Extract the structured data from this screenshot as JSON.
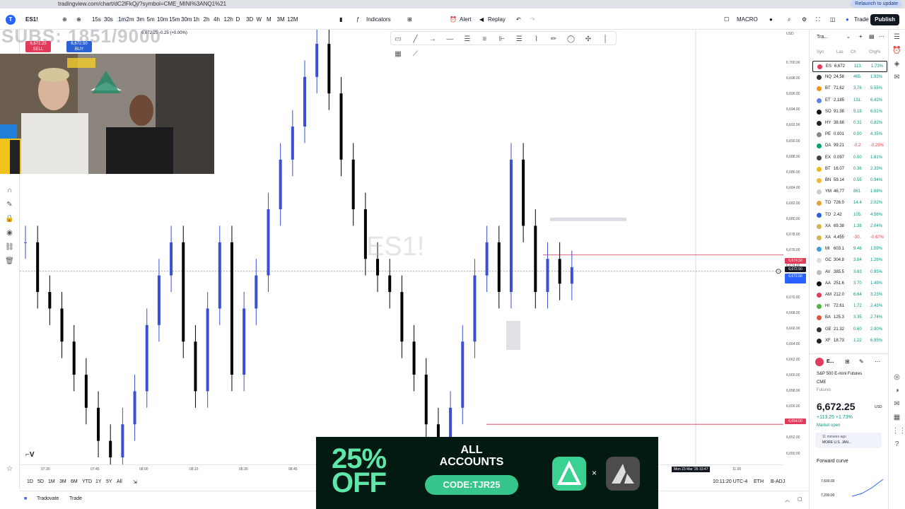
{
  "browser": {
    "url": "tradingview.com/chart/dC2lFkQj/?symbol=CME_MINI%3ANQ1%21",
    "relaunch_label": "Relaunch to update"
  },
  "toolbar": {
    "symbol": "ES1!",
    "intervals": [
      "15s",
      "30s",
      "1m",
      "2m",
      "3m",
      "5m",
      "10m",
      "15m",
      "30m",
      "1h",
      "2h",
      "4h",
      "12h",
      "D",
      "3D",
      "W",
      "M",
      "3M",
      "12M"
    ],
    "active_interval": "1m",
    "indicators_label": "Indicators",
    "alert_label": "Alert",
    "replay_label": "Replay",
    "layout_name": "MACRO",
    "trade_label": "Trade",
    "publish_label": "Publish"
  },
  "ohlc": "6,672.25 -0.25 (+0.00%)",
  "order_panel": {
    "sell_price": "6,672.25",
    "sell_label": "SELL",
    "buy_price": "6,672.50",
    "buy_label": "BUY"
  },
  "stream_overlay": {
    "sub_goal_text": "SUBS: 1851/9000"
  },
  "symbol_watermark": "ES1!",
  "price_axis": {
    "currency": "USD",
    "ticks": [
      "6,700.00",
      "6,698.00",
      "6,696.00",
      "6,694.00",
      "6,692.00",
      "6,690.00",
      "6,688.00",
      "6,686.00",
      "6,684.00",
      "6,682.00",
      "6,680.00",
      "6,678.00",
      "6,676.00",
      "6,674.00",
      "6,672.00",
      "6,670.00",
      "6,668.00",
      "6,666.00",
      "6,664.00",
      "6,662.00",
      "6,660.00",
      "6,658.00",
      "6,656.00",
      "6,654.00",
      "6,652.00",
      "6,650.00"
    ],
    "label_red_1": "6,674.50",
    "label_current": "6,672.50",
    "label_blue": "6,672.50",
    "label_red_2": "6,654.00"
  },
  "time_axis": {
    "ticks": [
      "07:30",
      "07:45",
      "08:00",
      "08:15",
      "08:30",
      "08:45",
      "11:00"
    ],
    "crosshair_label": "Mon 23 Mar '26  10:47"
  },
  "bottom_bar": {
    "ranges": [
      "1D",
      "5D",
      "1M",
      "3M",
      "6M",
      "YTD",
      "1Y",
      "5Y",
      "All"
    ],
    "clock": "10:11:20 UTC-4",
    "session": "ETH",
    "adj": "B-ADJ"
  },
  "trading_bar": {
    "broker": "Tradovate",
    "trade_tab": "Trade"
  },
  "watchlist": {
    "title": "Tra...",
    "columns": [
      "Syn",
      "Las",
      "Ch",
      "Chg%"
    ],
    "rows": [
      {
        "sym": "ES",
        "last": "6,672",
        "chg": "113.",
        "pct": "1.73%",
        "color": "#e13a5a"
      },
      {
        "sym": "NQ",
        "last": "24,58",
        "chg": "465.",
        "pct": "1.93%",
        "color": "#333333"
      },
      {
        "sym": "BT",
        "last": "71,62",
        "chg": "3,76",
        "pct": "5.55%",
        "color": "#f7931a"
      },
      {
        "sym": "ET",
        "last": "2,185",
        "chg": "131.",
        "pct": "6.42%",
        "color": "#627eea"
      },
      {
        "sym": "SO",
        "last": "91.38",
        "chg": "5.18",
        "pct": "6.01%",
        "color": "#111111"
      },
      {
        "sym": "HY",
        "last": "38.68",
        "chg": "0.31",
        "pct": "0.82%",
        "color": "#222222"
      },
      {
        "sym": "PE",
        "last": "0.001",
        "chg": "0.00",
        "pct": "4.35%",
        "color": "#888888"
      },
      {
        "sym": "DA",
        "last": "99.21",
        "chg": "-0.2",
        "pct": "-0.29%",
        "color": "#00a36c"
      },
      {
        "sym": "EX",
        "last": "0.097",
        "chg": "0.00",
        "pct": "1.81%",
        "color": "#444444"
      },
      {
        "sym": "BT",
        "last": "16.07",
        "chg": "0.36",
        "pct": "2.33%",
        "color": "#f0b90b"
      },
      {
        "sym": "BN",
        "last": "59.14",
        "chg": "0.55",
        "pct": "0.94%",
        "color": "#f3ba2f"
      },
      {
        "sym": "YM",
        "last": "46,77",
        "chg": "861",
        "pct": "1.88%",
        "color": "#cccccc"
      },
      {
        "sym": "TO",
        "last": "726.0",
        "chg": "14.4",
        "pct": "2.02%",
        "color": "#e8a33b"
      },
      {
        "sym": "TO",
        "last": "2.42",
        "chg": "105.",
        "pct": "4.56%",
        "color": "#2b62d6"
      },
      {
        "sym": "XA",
        "last": "69.38",
        "chg": "1.38",
        "pct": "2.04%",
        "color": "#d6b44c"
      },
      {
        "sym": "XA",
        "last": "4,455",
        "chg": "-30.",
        "pct": "-0.67%",
        "color": "#d6b44c"
      },
      {
        "sym": "MI",
        "last": "603.1",
        "chg": "9.46",
        "pct": "1.59%",
        "color": "#3aa0e0"
      },
      {
        "sym": "GC",
        "last": "304.8",
        "chg": "3.84",
        "pct": "1.26%",
        "color": "#dddddd"
      },
      {
        "sym": "AV",
        "last": "385.5",
        "chg": "3.63",
        "pct": "0.95%",
        "color": "#bbbbbb"
      },
      {
        "sym": "AA",
        "last": "251.6",
        "chg": "3.70",
        "pct": "1.49%",
        "color": "#111111"
      },
      {
        "sym": "AM",
        "last": "212.0",
        "chg": "6.64",
        "pct": "3.23%",
        "color": "#e13a5a"
      },
      {
        "sym": "HI",
        "last": "72.61",
        "chg": "1.72",
        "pct": "2.43%",
        "color": "#4cbb3a"
      },
      {
        "sym": "BA",
        "last": "125.3",
        "chg": "3.35",
        "pct": "2.74%",
        "color": "#e2543a"
      },
      {
        "sym": "GE",
        "last": "21.32",
        "chg": "0.60",
        "pct": "2.90%",
        "color": "#333333"
      },
      {
        "sym": "XF",
        "last": "18.73",
        "chg": "1.22",
        "pct": "6.95%",
        "color": "#222222"
      }
    ]
  },
  "details": {
    "symbol_short": "E...",
    "name": "S&P 500 E-mini Futures",
    "exchange": "CME",
    "type": "Futures",
    "price": "6,672.25",
    "currency": "USD",
    "change": "+113.25 +1.73%",
    "market_status": "Market open",
    "news_time": "11 minutes ago",
    "news_text": "MORE U.S. JAN...",
    "forward_curve_label": "Forward curve",
    "curve_ticks": [
      "7,600.00",
      "7,200.00"
    ]
  },
  "ad": {
    "discount": "25% OFF",
    "line1": "ALL",
    "line2": "ACCOUNTS",
    "code": "CODE:TJR25",
    "times": "×"
  },
  "colors": {
    "accent": "#2962ff",
    "up_candle": "#3a4fd6",
    "down_candle": "#000000",
    "red_line": "#e13a5a",
    "green_brand": "#3ad192"
  },
  "chart_data": {
    "type": "candlestick",
    "title": "",
    "symbol": "ES1!",
    "interval": "1m",
    "ylim": [
      6650,
      6700
    ],
    "x_ticks": [
      "07:30",
      "07:45",
      "08:00",
      "08:15",
      "08:30",
      "08:45"
    ],
    "horizontal_levels": [
      6674.5,
      6672.5,
      6654.0
    ],
    "close_prices": [
      6676,
      6670,
      6668,
      6664,
      6660,
      6656,
      6652,
      6650,
      6654,
      6658,
      6666,
      6672,
      6676,
      6664,
      6658,
      6668,
      6676,
      6660,
      6668,
      6672,
      6680,
      6686,
      6690,
      6696,
      6700,
      6694,
      6686,
      6680,
      6674,
      6672,
      6670,
      6664,
      6660,
      6654,
      6650,
      6656,
      6664,
      6672,
      6676,
      6670,
      6686,
      6678,
      6670,
      6674,
      6671,
      6673
    ]
  }
}
